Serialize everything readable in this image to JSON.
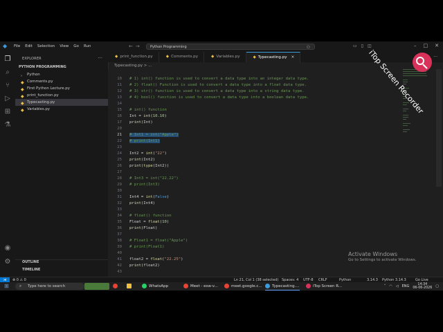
{
  "window": {
    "menu": [
      "File",
      "Edit",
      "Selection",
      "View",
      "Go",
      "Run"
    ],
    "search_text": "Python Programming"
  },
  "sidebar": {
    "explorer_title": "EXPLORER",
    "folder": "PYTHON PROGRAMMING",
    "files": [
      {
        "name": "Python",
        "type": "folder"
      },
      {
        "name": "Comments.py",
        "type": "py"
      },
      {
        "name": "First Python Lecture.py",
        "type": "py"
      },
      {
        "name": "print_function.py",
        "type": "py"
      },
      {
        "name": "Typecasting.py",
        "type": "py",
        "active": true
      },
      {
        "name": "Variables.py",
        "type": "py"
      }
    ],
    "outline": "OUTLINE",
    "timeline": "TIMELINE"
  },
  "tabs": [
    {
      "label": "print_function.py",
      "active": false
    },
    {
      "label": "Comments.py",
      "active": false
    },
    {
      "label": "Variables.py",
      "active": false
    },
    {
      "label": "Typecasting.py",
      "active": true
    }
  ],
  "breadcrumb": "Typecasting.py > ...",
  "editor": {
    "lines": [
      {
        "n": "10",
        "text": "# 1) int() function is used to convert a data type into an integer data type."
      },
      {
        "n": "11",
        "text": "# 2) float() Function is used to convert a data type into a float data type."
      },
      {
        "n": "12",
        "text": "# 3) str() function is used to convert a data type into a string data type."
      },
      {
        "n": "13",
        "text": "# 4) bool() function is used to convert a data type into a boolean data type."
      },
      {
        "n": "14",
        "text": ""
      },
      {
        "n": "15",
        "text": "# int() function"
      },
      {
        "n": "16",
        "text": "Int = int(10.10)"
      },
      {
        "n": "17",
        "text": "print(Int)"
      },
      {
        "n": "20",
        "text": ""
      },
      {
        "n": "21",
        "text": "# Int1 = int(\"Apple\")"
      },
      {
        "n": "22",
        "text": "# print(Int1)"
      },
      {
        "n": "23",
        "text": ""
      },
      {
        "n": "24",
        "text": "Int2 = int(\"22\")"
      },
      {
        "n": "25",
        "text": "print(Int2)"
      },
      {
        "n": "26",
        "text": "print(type(Int2))"
      },
      {
        "n": "27",
        "text": ""
      },
      {
        "n": "28",
        "text": "# Int3 = int(\"22.22\")"
      },
      {
        "n": "29",
        "text": "# print(Int3)"
      },
      {
        "n": "30",
        "text": ""
      },
      {
        "n": "31",
        "text": "Int4 = int(False)"
      },
      {
        "n": "32",
        "text": "print(Int4)"
      },
      {
        "n": "33",
        "text": ""
      },
      {
        "n": "34",
        "text": "# float() function"
      },
      {
        "n": "35",
        "text": "Float = float(10)"
      },
      {
        "n": "36",
        "text": "print(Float)"
      },
      {
        "n": "37",
        "text": ""
      },
      {
        "n": "38",
        "text": "# Float1 = float(\"Apple\")"
      },
      {
        "n": "39",
        "text": "# print(Float1)"
      },
      {
        "n": "40",
        "text": ""
      },
      {
        "n": "41",
        "text": "float2 = float(\"22.25\")"
      },
      {
        "n": "42",
        "text": "print(float2)"
      },
      {
        "n": "43",
        "text": ""
      }
    ]
  },
  "statusbar": {
    "position": "Ln 21, Col 1 (38 selected)",
    "spaces": "Spaces: 4",
    "encoding": "UTF-8",
    "eol": "CRLF",
    "language": "Python",
    "version": "3.14.3",
    "interpreter": "Python 3.14.3",
    "golive": "Go Live"
  },
  "taskbar": {
    "search_placeholder": "Type here to search",
    "apps": [
      "WhatsApp",
      "Meet - esw-v...",
      "meet.google.c...",
      "Typecasting....",
      "iTop Screen R..."
    ],
    "lang": "ENG",
    "time": "14:34",
    "date": "06-06-2026"
  },
  "watermark": {
    "activate_title": "Activate Windows",
    "activate_sub": "Go to Settings to activate Windows.",
    "itop": "iTop Screen Recorder"
  },
  "colors": {
    "accent": "#0078d4",
    "comment": "#6a9955",
    "function": "#dcdcaa",
    "string": "#ce9178",
    "number": "#b5cea8",
    "selection": "#264f78"
  }
}
